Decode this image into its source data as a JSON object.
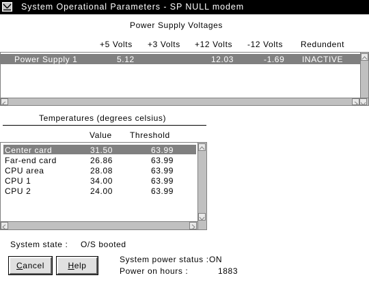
{
  "window": {
    "title": "System Operational Parameters - SP NULL modem"
  },
  "power": {
    "heading": "Power Supply Voltages",
    "columns": [
      "+5 Volts",
      "+3 Volts",
      "+12 Volts",
      "-12 Volts",
      "Redundent"
    ],
    "rows": [
      {
        "name": "Power Supply 1",
        "v5": "5.12",
        "v3": "",
        "v12": "12.03",
        "vm12": "-1.69",
        "redundant": "INACTIVE"
      }
    ]
  },
  "temps": {
    "heading": "Temperatures (degrees celsius)",
    "columns": [
      "Value",
      "Threshold"
    ],
    "rows": [
      {
        "name": "Center card",
        "value": "31.50",
        "threshold": "63.99"
      },
      {
        "name": "Far-end card",
        "value": "26.86",
        "threshold": "63.99"
      },
      {
        "name": "CPU area",
        "value": "28.08",
        "threshold": "63.99"
      },
      {
        "name": "CPU 1",
        "value": "34.00",
        "threshold": "63.99"
      },
      {
        "name": "CPU 2",
        "value": "24.00",
        "threshold": "63.99"
      }
    ]
  },
  "status": {
    "state_label": "System state :",
    "state_value": "O/S booted",
    "power_status_label": "System power status :",
    "power_status_value": "ON",
    "hours_label": "Power on hours :",
    "hours_value": "1883"
  },
  "buttons": {
    "cancel_mnemonic": "C",
    "cancel_rest": "ancel",
    "help_mnemonic": "H",
    "help_rest": "elp"
  },
  "colors": {
    "titlebar": "#000000",
    "selection": "#808080",
    "scrollbar": "#c0c0c0"
  }
}
